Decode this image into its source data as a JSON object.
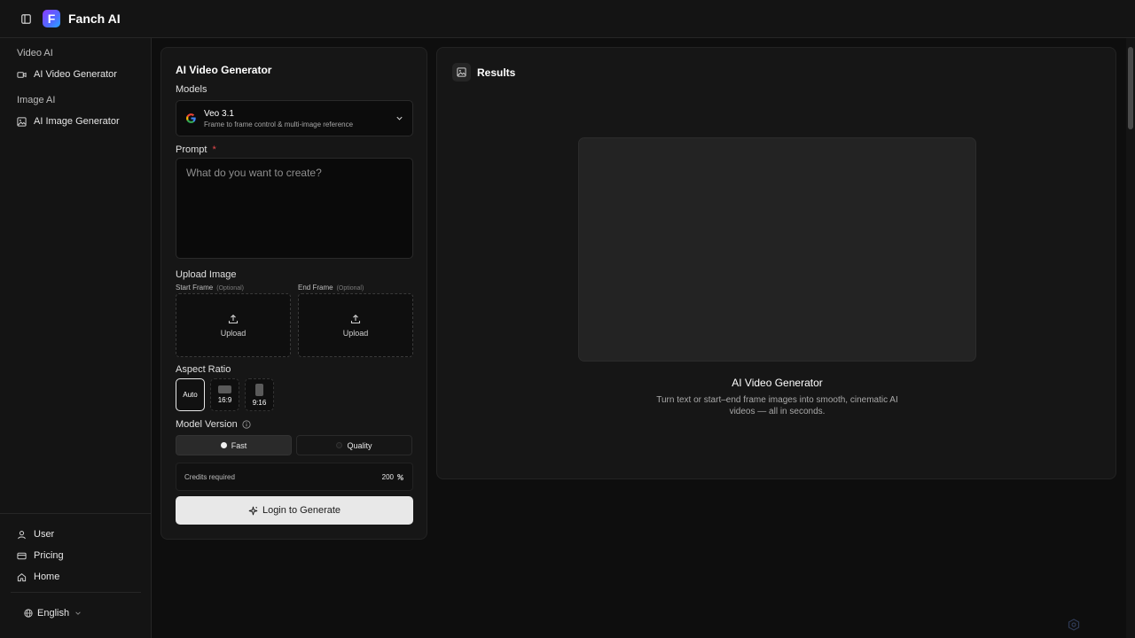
{
  "header": {
    "brand": "Fanch AI",
    "logo_letter": "F"
  },
  "sidebar": {
    "sections": [
      {
        "title": "Video AI",
        "items": [
          {
            "label": "AI Video Generator",
            "icon": "video-icon"
          }
        ]
      },
      {
        "title": "Image AI",
        "items": [
          {
            "label": "AI Image Generator",
            "icon": "image-icon"
          }
        ]
      }
    ],
    "bottom_items": [
      {
        "label": "User",
        "icon": "user-icon"
      },
      {
        "label": "Pricing",
        "icon": "card-icon"
      },
      {
        "label": "Home",
        "icon": "home-icon"
      }
    ],
    "language": "English"
  },
  "generator": {
    "title": "AI Video Generator",
    "models_label": "Models",
    "model": {
      "name": "Veo 3.1",
      "description": "Frame to frame control & multi-image reference"
    },
    "prompt_label": "Prompt",
    "prompt_required": "*",
    "prompt_placeholder": "What do you want to create?",
    "upload_label": "Upload Image",
    "start_frame": {
      "label": "Start Frame",
      "optional": "(Optional)",
      "button": "Upload"
    },
    "end_frame": {
      "label": "End Frame",
      "optional": "(Optional)",
      "button": "Upload"
    },
    "aspect_label": "Aspect Ratio",
    "aspect_options": [
      "Auto",
      "16:9",
      "9:16"
    ],
    "aspect_selected": "Auto",
    "version_label": "Model Version",
    "versions": [
      "Fast",
      "Quality"
    ],
    "version_selected": "Fast",
    "credits_label": "Credits required",
    "credits_value": "200",
    "generate_label": "Login to Generate"
  },
  "results": {
    "title": "Results",
    "empty_title": "AI Video Generator",
    "empty_desc": "Turn text or start–end frame images into smooth, cinematic AI videos — all in seconds."
  },
  "colors": {
    "accent": "#e8e8e8",
    "required": "#e5484d",
    "logo_gradient_start": "#8a3cff",
    "logo_gradient_end": "#27a8ff"
  }
}
